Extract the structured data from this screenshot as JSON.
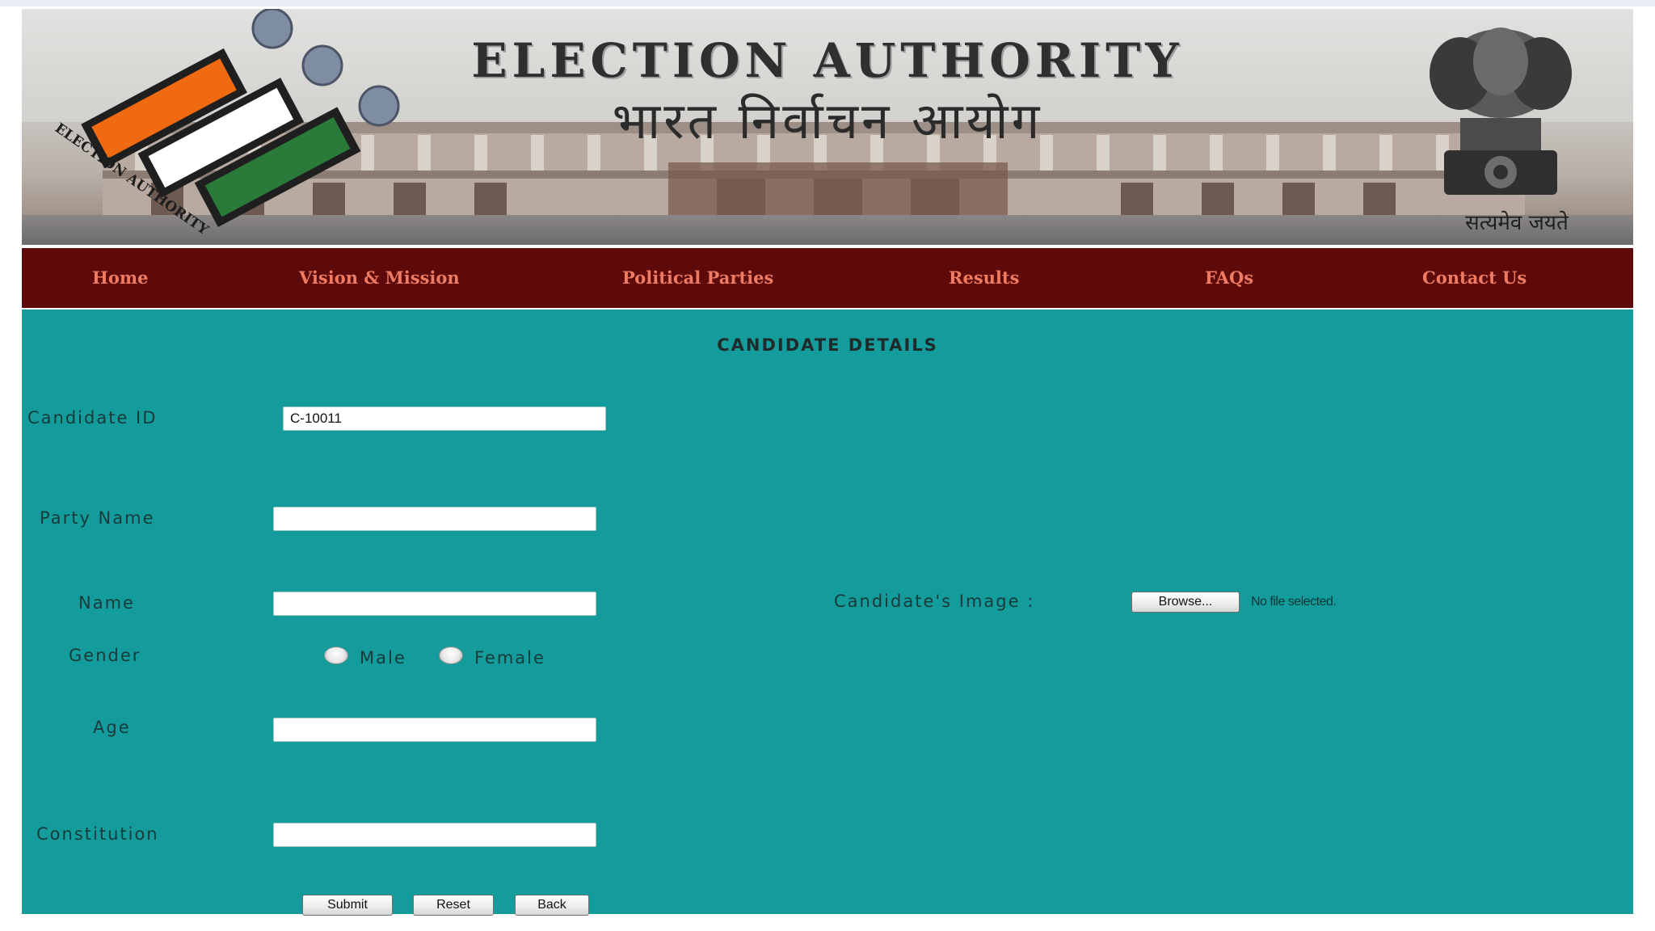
{
  "header": {
    "title_en": "ELECTION AUTHORITY",
    "title_hi": "भारत निर्वाचन आयोग",
    "logo_text": "ELECTION AUTHORITY",
    "emblem_motto": "सत्यमेव जयते",
    "logo_stripe_colors": [
      "#f06a12",
      "#ffffff",
      "#2a7a3a"
    ]
  },
  "nav": {
    "items": [
      "Home",
      "Vision & Mission",
      "Political Parties",
      "Results",
      "FAQs",
      "Contact Us"
    ],
    "background": "#5f0a0a",
    "text_color": "#ef7b62"
  },
  "form": {
    "title": "CANDIDATE DETAILS",
    "background": "#149c9c",
    "candidate_id": {
      "label": "Candidate ID",
      "value": "C-10011"
    },
    "party_name": {
      "label": "Party Name",
      "value": ""
    },
    "name": {
      "label": "Name",
      "value": ""
    },
    "gender": {
      "label": "Gender",
      "options": [
        "Male",
        "Female"
      ],
      "selected": ""
    },
    "age": {
      "label": "Age",
      "value": ""
    },
    "constitution": {
      "label": "Constitution",
      "value": ""
    },
    "image": {
      "label": "Candidate's Image :",
      "browse_label": "Browse...",
      "status": "No file selected."
    },
    "buttons": {
      "submit": "Submit",
      "reset": "Reset",
      "back": "Back"
    }
  }
}
